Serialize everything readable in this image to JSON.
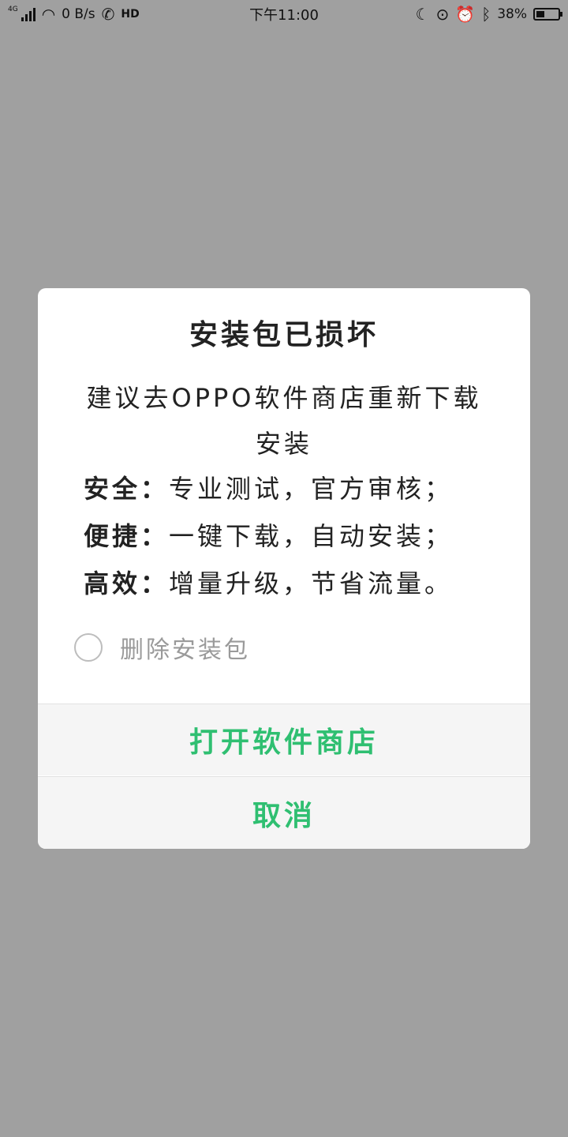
{
  "status_bar": {
    "network_type": "4G",
    "data_rate": "0 B/s",
    "hd_label": "HD",
    "time": "下午11:00",
    "battery_percent": "38%",
    "battery_level": 0.38,
    "icons": [
      "signal-icon",
      "wifi-icon",
      "hd-call-icon",
      "moon-icon",
      "lock-rotation-icon",
      "alarm-icon",
      "bluetooth-icon",
      "battery-icon"
    ]
  },
  "dialog": {
    "title": "安装包已损坏",
    "message": "建议去OPPO软件商店重新下载安装",
    "features": [
      {
        "label": "安全：",
        "value": "专业测试，官方审核；"
      },
      {
        "label": "便捷：",
        "value": "一键下载，自动安装；"
      },
      {
        "label": "高效：",
        "value": "增量升级，节省流量。"
      }
    ],
    "checkbox_label": "删除安装包",
    "checkbox_checked": false,
    "open_store_button": "打开软件商店",
    "cancel_button": "取消",
    "accent_color": "#2fbf71"
  }
}
